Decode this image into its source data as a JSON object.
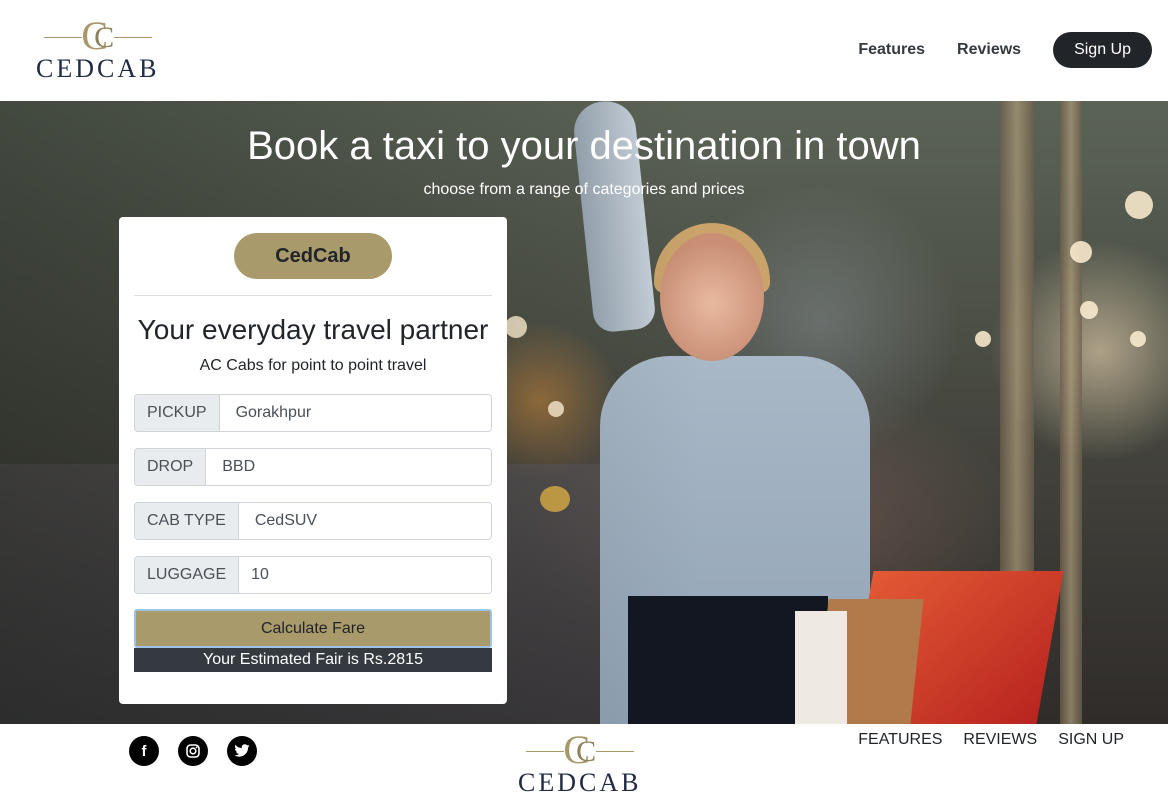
{
  "brand": {
    "logo_mark": "CC",
    "logo_text": "CEDCAB"
  },
  "header": {
    "nav": [
      "Features",
      "Reviews"
    ],
    "signup_label": "Sign Up"
  },
  "hero": {
    "title": "Book a taxi to your destination in town",
    "subtitle": "choose from a range of categories and prices"
  },
  "card": {
    "brand_label": "CedCab",
    "title": "Your everyday travel partner",
    "subtitle": "AC Cabs for point to point travel",
    "fields": [
      {
        "label": "PICKUP",
        "value": "Gorakhpur"
      },
      {
        "label": "DROP",
        "value": "BBD"
      },
      {
        "label": "CAB TYPE",
        "value": "CedSUV"
      },
      {
        "label": "LUGGAGE",
        "value": "10"
      }
    ],
    "calculate_label": "Calculate Fare",
    "fare_text": "Your Estimated Fair is Rs.2815"
  },
  "footer": {
    "socials": [
      "facebook-icon",
      "instagram-icon",
      "twitter-icon"
    ],
    "nav": [
      "FEATURES",
      "REVIEWS",
      "SIGN UP"
    ]
  },
  "colors": {
    "accent": "#a89a6a",
    "dark": "#212529",
    "fare_bar": "#343a40"
  }
}
